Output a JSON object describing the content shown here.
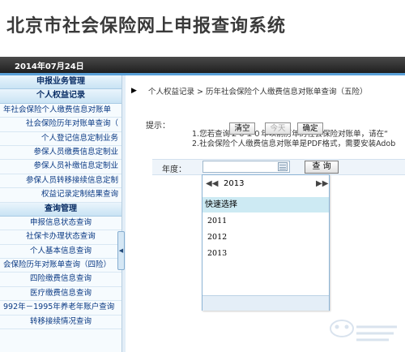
{
  "app": {
    "title": "北京市社会保险网上申报查询系统"
  },
  "topbar": {
    "date": "2014年07月24日"
  },
  "sidebar": {
    "items": [
      {
        "label": "申报业务管理",
        "type": "header",
        "clip": "none"
      },
      {
        "label": "个人权益记录",
        "type": "header",
        "clip": "none"
      },
      {
        "label": "年社会保险个人缴费信息对账单",
        "type": "item",
        "clip": "right"
      },
      {
        "label": "社会保险历年对账单查询（",
        "type": "item",
        "clip": "left"
      },
      {
        "label": "个人登记信息定制业务",
        "type": "item",
        "clip": "left"
      },
      {
        "label": "参保人员缴费信息定制业",
        "type": "item",
        "clip": "left"
      },
      {
        "label": "参保人员补缴信息定制业",
        "type": "item",
        "clip": "left"
      },
      {
        "label": "参保人员转移接续信息定制",
        "type": "item",
        "clip": "left"
      },
      {
        "label": "权益记录定制结果查询",
        "type": "item",
        "clip": "left"
      },
      {
        "label": "查询管理",
        "type": "header",
        "clip": "none"
      },
      {
        "label": "申报信息状态查询",
        "type": "item",
        "clip": "none"
      },
      {
        "label": "社保卡办理状态查询",
        "type": "item",
        "clip": "none"
      },
      {
        "label": "个人基本信息查询",
        "type": "item",
        "clip": "none"
      },
      {
        "label": "会保险历年对账单查询（四险）",
        "type": "item",
        "clip": "right"
      },
      {
        "label": "四险缴费信息查询",
        "type": "item",
        "clip": "none"
      },
      {
        "label": "医疗缴费信息查询",
        "type": "item",
        "clip": "none"
      },
      {
        "label": "992年－1995年养老年账户查询",
        "type": "item",
        "clip": "right"
      },
      {
        "label": "转移接续情况查询",
        "type": "item",
        "clip": "none"
      }
    ]
  },
  "main": {
    "breadcrumb": "个人权益记录 > 历年社会保险个人缴费信息对账单查询（五险）",
    "hint_label": "提示：",
    "hint_lines": [
      "1.您若查询２０１０年以前历年的社会保险对账单，请在“",
      "2.社会保险个人缴费信息对账单是PDF格式，需要安装Adob"
    ],
    "year_label": "年度：",
    "year_value": "",
    "query_button": "查 询"
  },
  "picker": {
    "prev": "◀◀",
    "year": "2013",
    "next": "▶▶",
    "quick_select": "快速选择",
    "options": [
      "2011",
      "2012",
      "2013"
    ],
    "clear_button": "清空",
    "today_button": "今天",
    "ok_button": "确定"
  },
  "colors": {
    "sidebar_link": "#0b3a84",
    "sidebar_header": "#0a2e66",
    "accent_bar": "#5aa0d8",
    "picker_highlight": "#cdeaf3"
  }
}
